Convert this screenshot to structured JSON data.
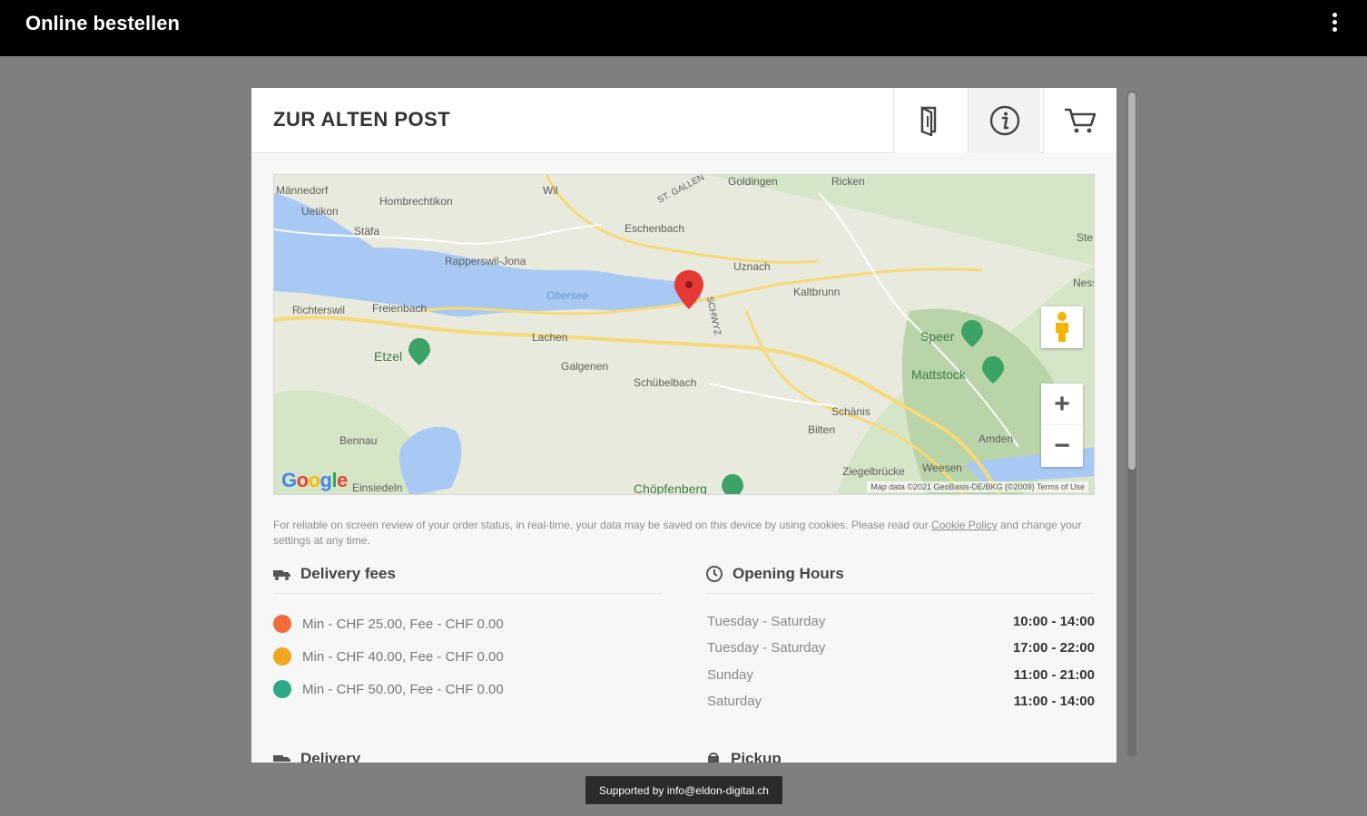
{
  "app": {
    "title": "Online bestellen"
  },
  "restaurant": {
    "name": "ZUR ALTEN POST"
  },
  "tabs": [
    {
      "icon": "menu-book-icon",
      "active": false
    },
    {
      "icon": "info-icon",
      "active": true
    },
    {
      "icon": "cart-icon",
      "active": false
    }
  ],
  "map": {
    "labels": {
      "mannedorf": "Männedorf",
      "hombrechtikon": "Hombrechtikon",
      "uetzikon": "Uetikon",
      "stafa": "Stäfa",
      "wil": "Wil",
      "goldingen": "Goldingen",
      "ricken": "Ricken",
      "eschenbach": "Eschenbach",
      "rapperswil": "Rapperswil-Jona",
      "uznach": "Uznach",
      "obersee": "Obersee",
      "kaltbrunn": "Kaltbrunn",
      "richterswil": "Richterswil",
      "freienbach": "Freienbach",
      "lachen": "Lachen",
      "speer": "Speer",
      "etzel": "Etzel",
      "galgenen": "Galgenen",
      "schubelbach": "Schübelbach",
      "mattstock": "Mattstock",
      "schanis": "Schänis",
      "bilten": "Bilten",
      "amden": "Amden",
      "bennau": "Bennau",
      "einsiedeln": "Einsiedeln",
      "chopfenberg": "Chöpfenberg",
      "ziegelbrucke": "Ziegelbrücke",
      "weesen": "Weesen",
      "stgallen": "ST. GALLEN",
      "schwyz": "SCHWYZ",
      "nesslau": "Ness",
      "stein": "Ste"
    },
    "logo": "Google",
    "attribution": "Map data ©2021 GeoBasis-DE/BKG (©2009)   Terms of Use",
    "zoom_in": "+",
    "zoom_out": "−"
  },
  "cookie": {
    "text_before": "For reliable on screen review of your order status, in real-time, your data may be saved on this device by using cookies. Please read our ",
    "link": "Cookie Policy",
    "text_after": " and change your settings at any time."
  },
  "delivery_fees": {
    "title": "Delivery fees",
    "items": [
      {
        "text": "Min - CHF 25.00, Fee - CHF 0.00",
        "color": "#f26b3a"
      },
      {
        "text": "Min - CHF 40.00, Fee - CHF 0.00",
        "color": "#f2a51f"
      },
      {
        "text": "Min - CHF 50.00, Fee - CHF 0.00",
        "color": "#2ea987"
      }
    ]
  },
  "opening_hours": {
    "title": "Opening Hours",
    "rows": [
      {
        "day": "Tuesday - Saturday",
        "time": "10:00 - 14:00"
      },
      {
        "day": "Tuesday - Saturday",
        "time": "17:00 - 22:00"
      },
      {
        "day": "Sunday",
        "time": "11:00 - 21:00"
      },
      {
        "day": "Saturday",
        "time": "11:00 - 14:00"
      }
    ]
  },
  "sections_below": {
    "delivery": "Delivery",
    "pickup": "Pickup"
  },
  "footer": {
    "support": "Supported by info@eldon-digital.ch"
  }
}
